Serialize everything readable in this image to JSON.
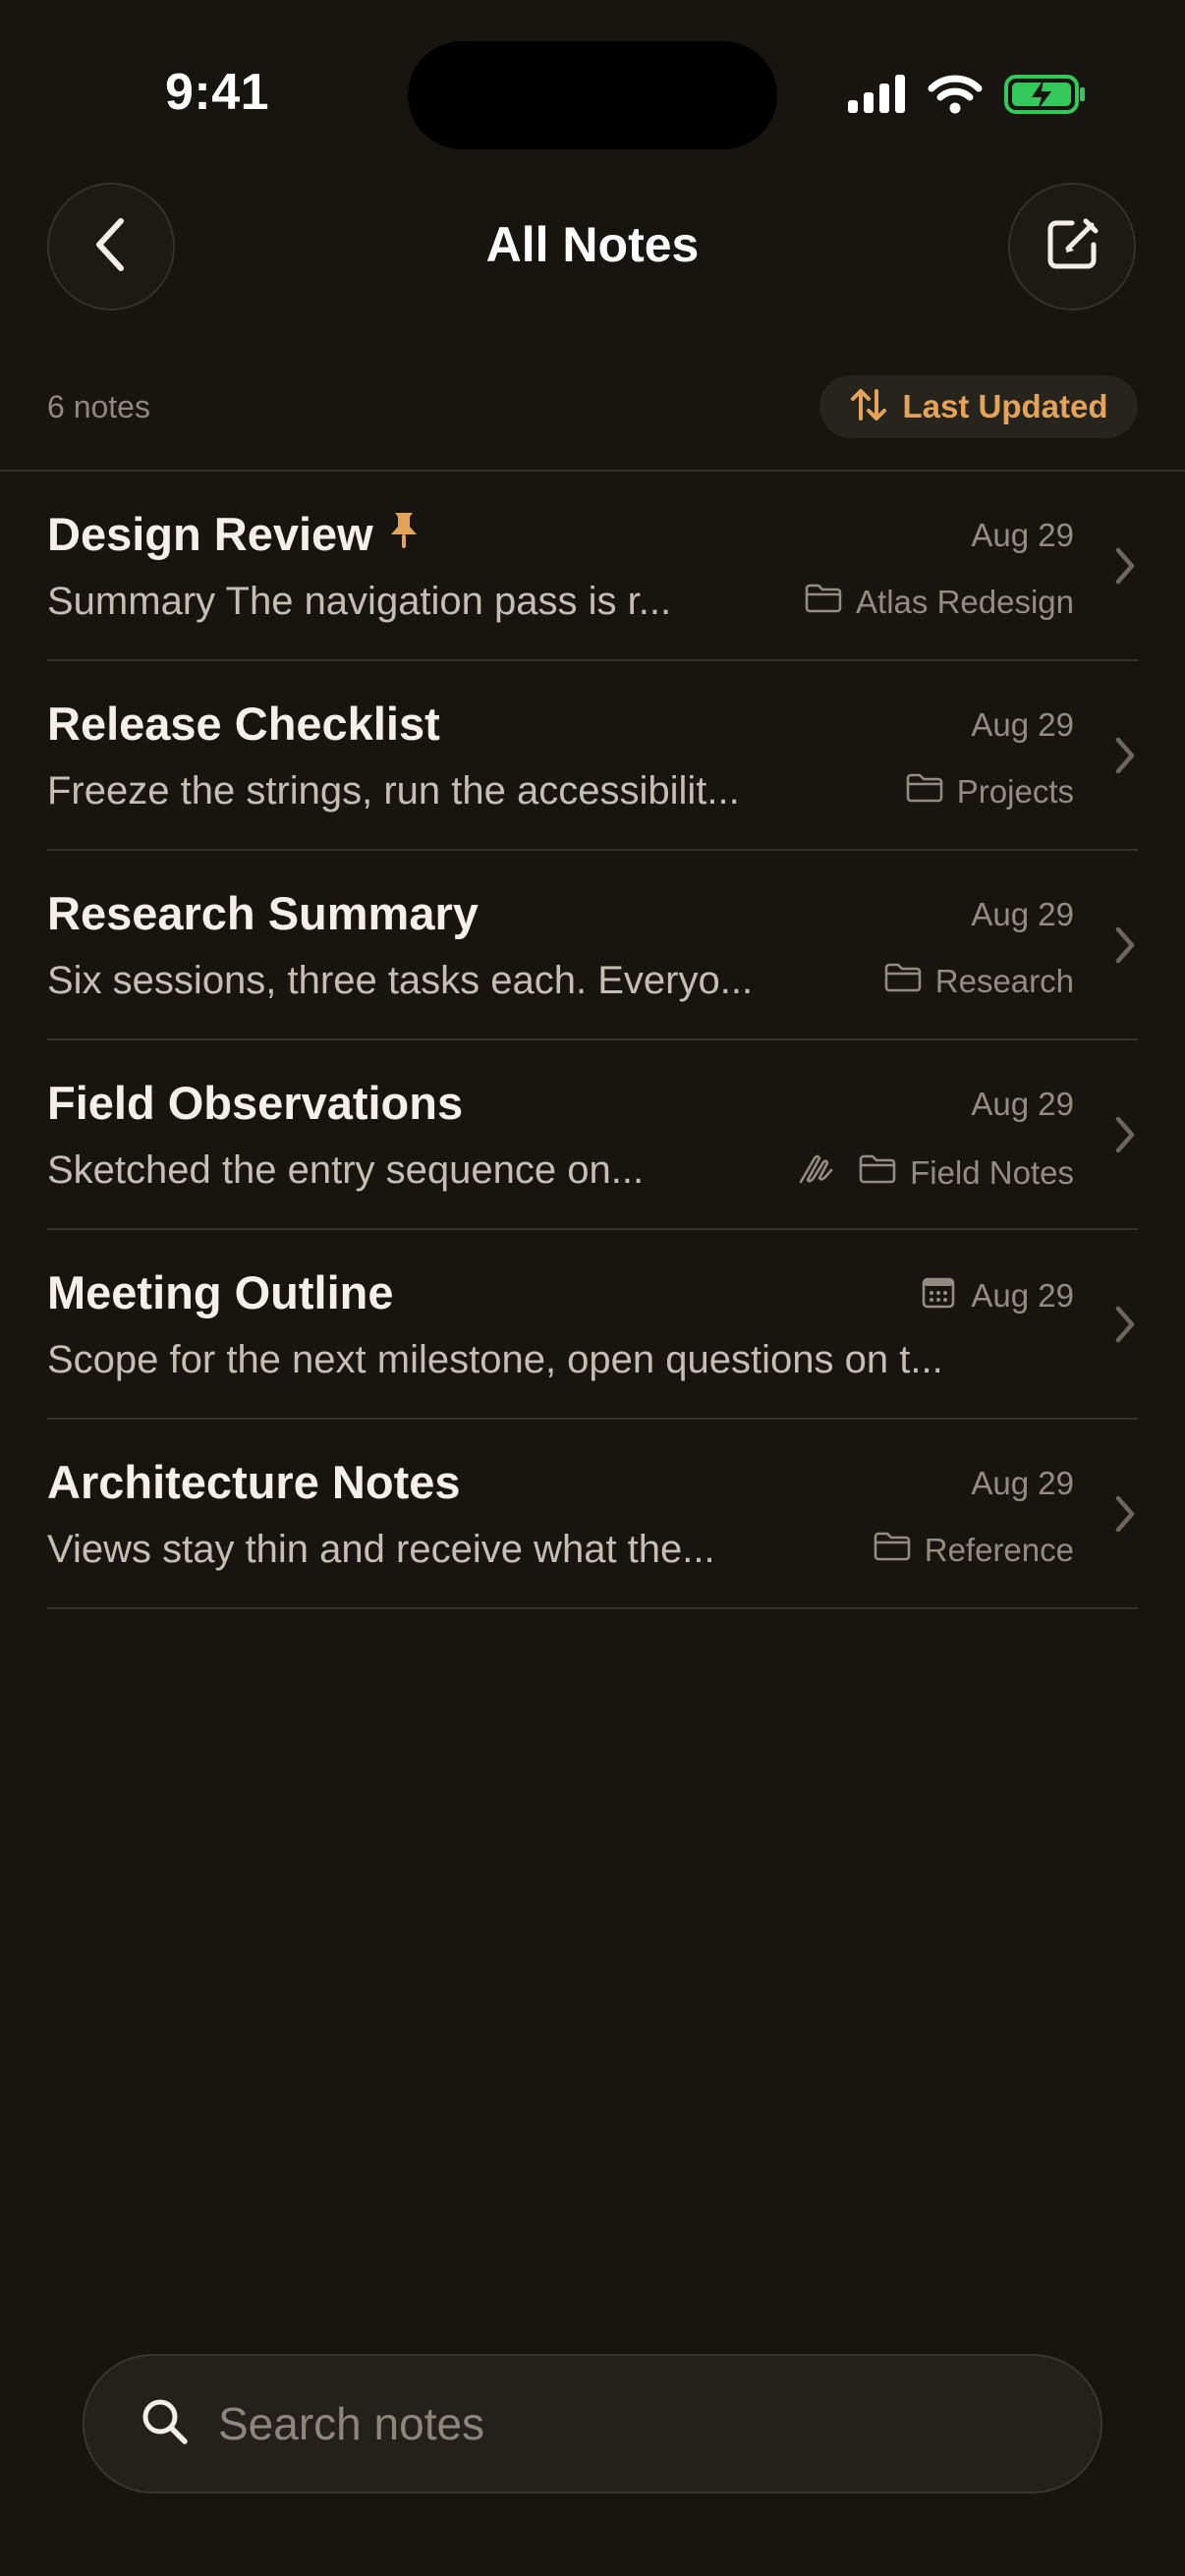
{
  "status_bar": {
    "time": "9:41"
  },
  "header": {
    "title": "All Notes"
  },
  "meta": {
    "count": "6 notes",
    "sort_label": "Last Updated"
  },
  "notes": [
    {
      "title": "Design Review",
      "pinned": true,
      "date": "Aug 29",
      "preview": "Summary The navigation pass is r...",
      "folder": "Atlas Redesign"
    },
    {
      "title": "Release Checklist",
      "date": "Aug 29",
      "preview": "Freeze the strings, run the accessibilit...",
      "folder": "Projects"
    },
    {
      "title": "Research Summary",
      "date": "Aug 29",
      "preview": "Six sessions, three tasks each. Everyo...",
      "folder": "Research"
    },
    {
      "title": "Field Observations",
      "date": "Aug 29",
      "preview": "Sketched the entry sequence on...",
      "folder": "Field Notes",
      "has_sketch": true
    },
    {
      "title": "Meeting Outline",
      "date": "Aug 29",
      "preview": "Scope for the next milestone, open questions on t...",
      "has_calendar": true
    },
    {
      "title": "Architecture Notes",
      "date": "Aug 29",
      "preview": "Views stay thin and receive what the...",
      "folder": "Reference"
    }
  ],
  "search": {
    "placeholder": "Search notes"
  },
  "colors": {
    "accent": "#e3a45a",
    "background": "#181511",
    "battery": "#34c759"
  }
}
